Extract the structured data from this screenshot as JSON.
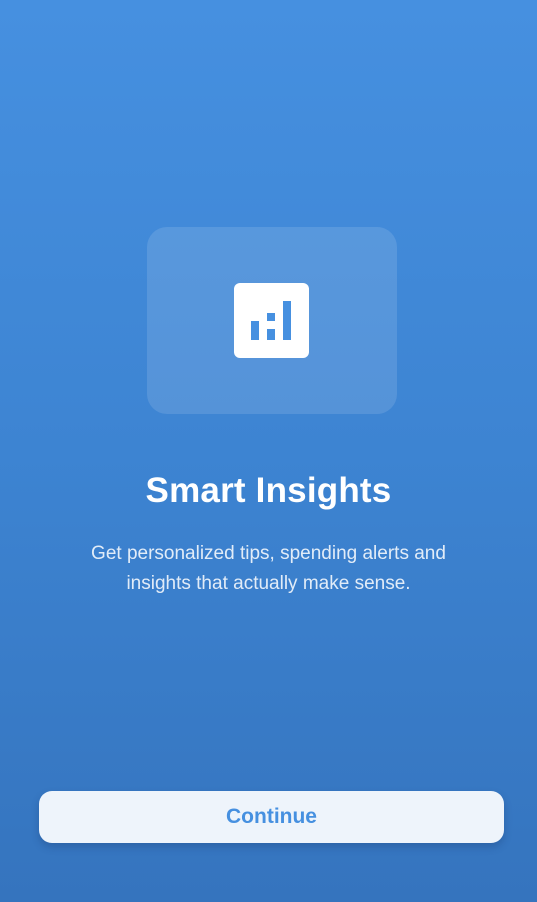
{
  "onboarding": {
    "icon": "bar-chart-icon",
    "title": "Smart Insights",
    "description": "Get personalized tips, spending alerts and insights that actually make sense.",
    "continue_label": "Continue"
  },
  "colors": {
    "background_top": "#4690E0",
    "background_bottom": "#3574BE",
    "accent": "#4690E0",
    "button_background": "#EEF4FB",
    "text_primary": "#FFFFFF"
  }
}
